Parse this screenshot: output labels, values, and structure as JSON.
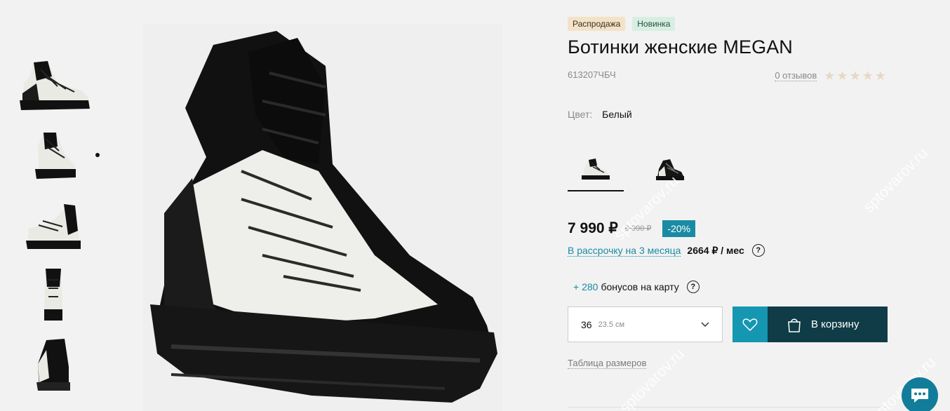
{
  "gallery": {
    "thumbnail_count": 5
  },
  "product": {
    "badges": [
      "Распродажа",
      "Новинка"
    ],
    "title": "Ботинки женские MEGAN",
    "sku": "613207ЧБЧ",
    "reviews_label": "0 отзывов",
    "rating": 0,
    "stars_total": 5,
    "color_label": "Цвет:",
    "color_value": "Белый",
    "variants": [
      "white",
      "black"
    ],
    "price": "7 990",
    "currency": "₽",
    "old_price": "9 990",
    "discount": "-20%",
    "installment_link": "В рассрочку на 3 месяца",
    "installment_amount": "2664 ₽ / мес",
    "help_icon": "?",
    "bonus_amount": "+ 280",
    "bonus_text": "бонусов на карту",
    "size": "36",
    "size_cm": "23.5 см",
    "cart_label": "В корзину",
    "size_table_link": "Таблица размеров"
  },
  "watermark": "sptovarov.ru",
  "colors": {
    "accent": "#1a8ba3",
    "favorite_button": "#1597b2",
    "cart_button": "#0f3c47",
    "sale_badge": "#f3e2c7",
    "new_badge": "#d8eee3"
  }
}
